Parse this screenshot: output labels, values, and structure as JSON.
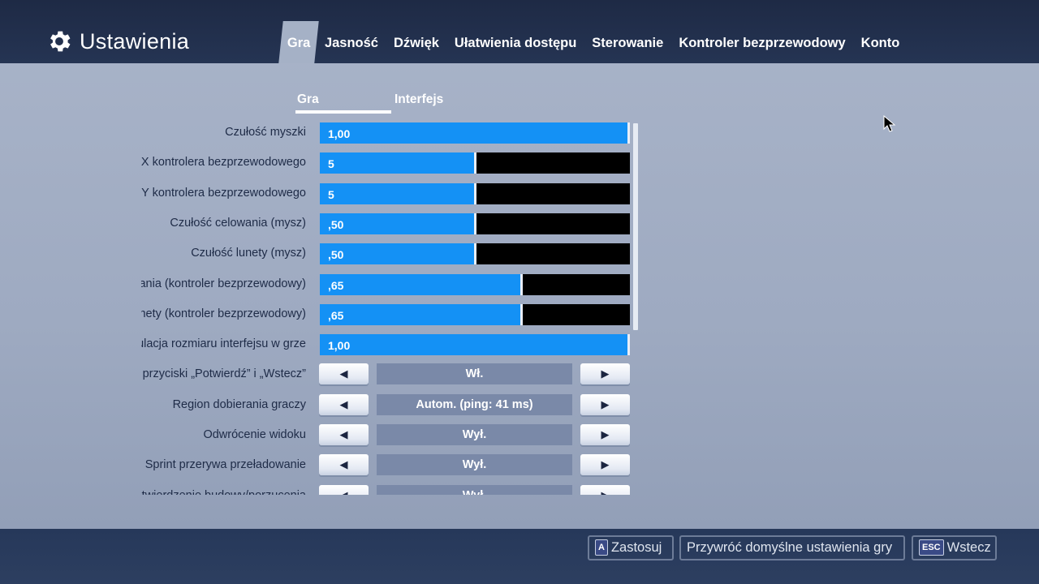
{
  "header": {
    "title": "Ustawienia",
    "tabs": [
      {
        "label": "Gra",
        "active": true
      },
      {
        "label": "Jasność"
      },
      {
        "label": "Dźwięk"
      },
      {
        "label": "Ułatwienia dostępu"
      },
      {
        "label": "Sterowanie"
      },
      {
        "label": "Kontroler bezprzewodowy"
      },
      {
        "label": "Konto"
      }
    ]
  },
  "subtabs": [
    {
      "label": "Gra",
      "active": true
    },
    {
      "label": "Interfejs"
    }
  ],
  "settings": [
    {
      "label": "Czułość myszki",
      "type": "slider",
      "value": "1,00",
      "level": 1.0
    },
    {
      "label": "Czułość osi X kontrolera bezprzewodowego",
      "type": "slider",
      "value": "5",
      "level": 0.5
    },
    {
      "label": "Czułość osi Y kontrolera bezprzewodowego",
      "type": "slider",
      "value": "5",
      "level": 0.5
    },
    {
      "label": "Czułość celowania (mysz)",
      "type": "slider",
      "value": ",50",
      "level": 0.5
    },
    {
      "label": "Czułość lunety (mysz)",
      "type": "slider",
      "value": ",50",
      "level": 0.5
    },
    {
      "label": "Czułość celowania (kontroler bezprzewodowy)",
      "type": "slider",
      "value": ",65",
      "level": 0.65
    },
    {
      "label": "Czułość lunety (kontroler bezprzewodowy)",
      "type": "slider",
      "value": ",65",
      "level": 0.65
    },
    {
      "label": "Regulacja rozmiaru interfejsu w grze",
      "type": "slider",
      "value": "1,00",
      "level": 1.0
    },
    {
      "label": "Zamień przyciski „Potwierdź” i „Wstecz”",
      "type": "option",
      "value": "Wł."
    },
    {
      "label": "Region dobierania graczy",
      "type": "option",
      "value": "Autom. (ping: 41 ms)"
    },
    {
      "label": "Odwrócenie widoku",
      "type": "option",
      "value": "Wył."
    },
    {
      "label": "Sprint przerywa przeładowanie",
      "type": "option",
      "value": "Wył."
    },
    {
      "label": "Potwierdzenie budowy/porzucenia",
      "type": "option",
      "value": "Wył."
    }
  ],
  "footer": {
    "apply_key": "A",
    "apply_label": "Zastosuj",
    "restore_label": "Przywróć domyślne ustawienia gry",
    "back_key": "ESC",
    "back_label": "Wstecz"
  },
  "colors": {
    "accent": "#1491f5",
    "topbar": "#1e2a45",
    "background": "#a9b4c9"
  }
}
